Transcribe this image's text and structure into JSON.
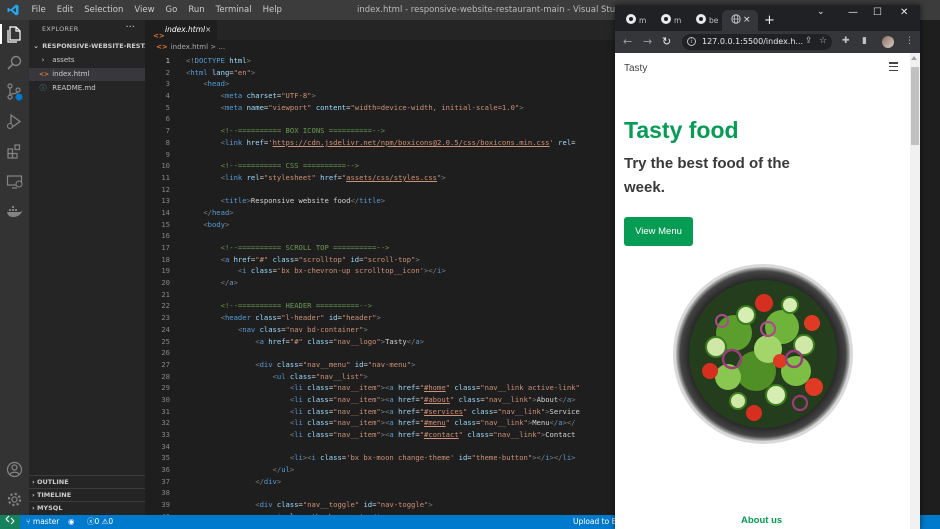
{
  "vscode": {
    "menu": [
      "File",
      "Edit",
      "Selection",
      "View",
      "Go",
      "Run",
      "Terminal",
      "Help"
    ],
    "window_title": "index.html - responsive-website-restaurant-main - Visual Studio Code",
    "explorer": {
      "header": "EXPLORER",
      "more": "···",
      "project": "RESPONSIVE-WEBSITE-RESTA...",
      "items": [
        {
          "label": "assets",
          "icon": "chevron-right-icon"
        },
        {
          "label": "index.html",
          "icon": "html-file-icon"
        },
        {
          "label": "README.md",
          "icon": "info-icon"
        }
      ],
      "sections": [
        "OUTLINE",
        "TIMELINE",
        "MYSQL"
      ]
    },
    "tab": {
      "label": "index.html",
      "close": "×",
      "icon_text": "<>"
    },
    "breadcrumb": "index.html > ...",
    "code_lines": [
      {
        "n": "1",
        "html": "<span class=\"g\">&lt;!</span><span class=\"t\">DOCTYPE</span> <span class=\"a\">html</span><span class=\"g\">&gt;</span>"
      },
      {
        "n": "2",
        "html": "<span class=\"g\">&lt;</span><span class=\"t\">html</span> <span class=\"a\">lang</span>=<span class=\"v\">\"en\"</span><span class=\"g\">&gt;</span>"
      },
      {
        "n": "3",
        "html": "    <span class=\"g\">&lt;</span><span class=\"t\">head</span><span class=\"g\">&gt;</span>"
      },
      {
        "n": "4",
        "html": "        <span class=\"g\">&lt;</span><span class=\"t\">meta</span> <span class=\"a\">charset</span>=<span class=\"v\">\"UTF-8\"</span><span class=\"g\">&gt;</span>"
      },
      {
        "n": "5",
        "html": "        <span class=\"g\">&lt;</span><span class=\"t\">meta</span> <span class=\"a\">name</span>=<span class=\"v\">\"viewport\"</span> <span class=\"a\">content</span>=<span class=\"v\">\"width=device-width, initial-scale=1.0\"</span><span class=\"g\">&gt;</span>"
      },
      {
        "n": "6",
        "html": ""
      },
      {
        "n": "7",
        "html": "        <span class=\"c\">&lt;!--========== BOX ICONS ==========--&gt;</span>"
      },
      {
        "n": "8",
        "html": "        <span class=\"g\">&lt;</span><span class=\"t\">link</span> <span class=\"a\">href</span>=<span class=\"v\">'<span class=\"u\">https://cdn.jsdelivr.net/npm/boxicons@2.0.5/css/boxicons.min.css</span>'</span> <span class=\"a\">rel</span>="
      },
      {
        "n": "9",
        "html": ""
      },
      {
        "n": "10",
        "html": "        <span class=\"c\">&lt;!--========== CSS ==========--&gt;</span>"
      },
      {
        "n": "11",
        "html": "        <span class=\"g\">&lt;</span><span class=\"t\">link</span> <span class=\"a\">rel</span>=<span class=\"v\">\"stylesheet\"</span> <span class=\"a\">href</span>=<span class=\"v\">\"<span class=\"u\">assets/css/styles.css</span>\"</span><span class=\"g\">&gt;</span>"
      },
      {
        "n": "12",
        "html": ""
      },
      {
        "n": "13",
        "html": "        <span class=\"g\">&lt;</span><span class=\"t\">title</span><span class=\"g\">&gt;</span>Responsive website food<span class=\"g\">&lt;/</span><span class=\"t\">title</span><span class=\"g\">&gt;</span>"
      },
      {
        "n": "14",
        "html": "    <span class=\"g\">&lt;/</span><span class=\"t\">head</span><span class=\"g\">&gt;</span>"
      },
      {
        "n": "15",
        "html": "    <span class=\"g\">&lt;</span><span class=\"t\">body</span><span class=\"g\">&gt;</span>"
      },
      {
        "n": "16",
        "html": ""
      },
      {
        "n": "17",
        "html": "        <span class=\"c\">&lt;!--========== SCROLL TOP ==========--&gt;</span>"
      },
      {
        "n": "18",
        "html": "        <span class=\"g\">&lt;</span><span class=\"t\">a</span> <span class=\"a\">href</span>=<span class=\"v\">\"#\"</span> <span class=\"a\">class</span>=<span class=\"v\">\"scrolltop\"</span> <span class=\"a\">id</span>=<span class=\"v\">\"scroll-top\"</span><span class=\"g\">&gt;</span>"
      },
      {
        "n": "19",
        "html": "            <span class=\"g\">&lt;</span><span class=\"t\">i</span> <span class=\"a\">class</span>=<span class=\"v\">'bx bx-chevron-up scrolltop__icon'</span><span class=\"g\">&gt;&lt;/</span><span class=\"t\">i</span><span class=\"g\">&gt;</span>"
      },
      {
        "n": "20",
        "html": "        <span class=\"g\">&lt;/</span><span class=\"t\">a</span><span class=\"g\">&gt;</span>"
      },
      {
        "n": "21",
        "html": ""
      },
      {
        "n": "22",
        "html": "        <span class=\"c\">&lt;!--========== HEADER ==========--&gt;</span>"
      },
      {
        "n": "23",
        "html": "        <span class=\"g\">&lt;</span><span class=\"t\">header</span> <span class=\"a\">class</span>=<span class=\"v\">\"l-header\"</span> <span class=\"a\">id</span>=<span class=\"v\">\"header\"</span><span class=\"g\">&gt;</span>"
      },
      {
        "n": "24",
        "html": "            <span class=\"g\">&lt;</span><span class=\"t\">nav</span> <span class=\"a\">class</span>=<span class=\"v\">\"nav bd-container\"</span><span class=\"g\">&gt;</span>"
      },
      {
        "n": "25",
        "html": "                <span class=\"g\">&lt;</span><span class=\"t\">a</span> <span class=\"a\">href</span>=<span class=\"v\">\"#\"</span> <span class=\"a\">class</span>=<span class=\"v\">\"nav__logo\"</span><span class=\"g\">&gt;</span>Tasty<span class=\"g\">&lt;/</span><span class=\"t\">a</span><span class=\"g\">&gt;</span>"
      },
      {
        "n": "26",
        "html": ""
      },
      {
        "n": "27",
        "html": "                <span class=\"g\">&lt;</span><span class=\"t\">div</span> <span class=\"a\">class</span>=<span class=\"v\">\"nav__menu\"</span> <span class=\"a\">id</span>=<span class=\"v\">\"nav-menu\"</span><span class=\"g\">&gt;</span>"
      },
      {
        "n": "28",
        "html": "                    <span class=\"g\">&lt;</span><span class=\"t\">ul</span> <span class=\"a\">class</span>=<span class=\"v\">\"nav__list\"</span><span class=\"g\">&gt;</span>"
      },
      {
        "n": "29",
        "html": "                        <span class=\"g\">&lt;</span><span class=\"t\">li</span> <span class=\"a\">class</span>=<span class=\"v\">\"nav__item\"</span><span class=\"g\">&gt;&lt;</span><span class=\"t\">a</span> <span class=\"a\">href</span>=<span class=\"v\">\"<span class=\"u\">#home</span>\"</span> <span class=\"a\">class</span>=<span class=\"v\">\"nav__link active-link\"</span>"
      },
      {
        "n": "30",
        "html": "                        <span class=\"g\">&lt;</span><span class=\"t\">li</span> <span class=\"a\">class</span>=<span class=\"v\">\"nav__item\"</span><span class=\"g\">&gt;&lt;</span><span class=\"t\">a</span> <span class=\"a\">href</span>=<span class=\"v\">\"<span class=\"u\">#about</span>\"</span> <span class=\"a\">class</span>=<span class=\"v\">\"nav__link\"</span><span class=\"g\">&gt;</span>About<span class=\"g\">&lt;/</span><span class=\"t\">a</span><span class=\"g\">&gt;</span>"
      },
      {
        "n": "31",
        "html": "                        <span class=\"g\">&lt;</span><span class=\"t\">li</span> <span class=\"a\">class</span>=<span class=\"v\">\"nav__item\"</span><span class=\"g\">&gt;&lt;</span><span class=\"t\">a</span> <span class=\"a\">href</span>=<span class=\"v\">\"<span class=\"u\">#services</span>\"</span> <span class=\"a\">class</span>=<span class=\"v\">\"nav__link\"</span><span class=\"g\">&gt;</span>Service"
      },
      {
        "n": "32",
        "html": "                        <span class=\"g\">&lt;</span><span class=\"t\">li</span> <span class=\"a\">class</span>=<span class=\"v\">\"nav__item\"</span><span class=\"g\">&gt;&lt;</span><span class=\"t\">a</span> <span class=\"a\">href</span>=<span class=\"v\">\"<span class=\"u\">#menu</span>\"</span> <span class=\"a\">class</span>=<span class=\"v\">\"nav__link\"</span><span class=\"g\">&gt;</span>Menu<span class=\"g\">&lt;/</span><span class=\"t\">a</span><span class=\"g\">&gt;&lt;/</span>"
      },
      {
        "n": "33",
        "html": "                        <span class=\"g\">&lt;</span><span class=\"t\">li</span> <span class=\"a\">class</span>=<span class=\"v\">\"nav__item\"</span><span class=\"g\">&gt;&lt;</span><span class=\"t\">a</span> <span class=\"a\">href</span>=<span class=\"v\">\"<span class=\"u\">#contact</span>\"</span> <span class=\"a\">class</span>=<span class=\"v\">\"nav__link\"</span><span class=\"g\">&gt;</span>Contact"
      },
      {
        "n": "34",
        "html": ""
      },
      {
        "n": "35",
        "html": "                        <span class=\"g\">&lt;</span><span class=\"t\">li</span><span class=\"g\">&gt;&lt;</span><span class=\"t\">i</span> <span class=\"a\">class</span>=<span class=\"v\">'bx bx-moon change-theme'</span> <span class=\"a\">id</span>=<span class=\"v\">\"theme-button\"</span><span class=\"g\">&gt;&lt;/</span><span class=\"t\">i</span><span class=\"g\">&gt;&lt;/</span><span class=\"t\">li</span><span class=\"g\">&gt;</span>"
      },
      {
        "n": "36",
        "html": "                    <span class=\"g\">&lt;/</span><span class=\"t\">ul</span><span class=\"g\">&gt;</span>"
      },
      {
        "n": "37",
        "html": "                <span class=\"g\">&lt;/</span><span class=\"t\">div</span><span class=\"g\">&gt;</span>"
      },
      {
        "n": "38",
        "html": ""
      },
      {
        "n": "39",
        "html": "                <span class=\"g\">&lt;</span><span class=\"t\">div</span> <span class=\"a\">class</span>=<span class=\"v\">\"nav__toggle\"</span> <span class=\"a\">id</span>=<span class=\"v\">\"nav-toggle\"</span><span class=\"g\">&gt;</span>"
      },
      {
        "n": "40",
        "html": "                    <span class=\"g\">&lt;</span><span class=\"t\">i</span> <span class=\"a\">class</span>=<span class=\"v\">'bx bx-menu'</span><span class=\"g\">&gt;&lt;/</span><span class=\"t\">i</span><span class=\"g\">&gt;</span>"
      }
    ],
    "status": {
      "branch": "master",
      "errors": "0",
      "warnings": "0",
      "right_text": "Upload to Bl"
    }
  },
  "browser": {
    "tabs": [
      {
        "label": "m",
        "icon": "github-icon"
      },
      {
        "label": "m",
        "icon": "github-icon"
      },
      {
        "label": "be",
        "icon": "github-icon"
      },
      {
        "label": "",
        "icon": "globe-icon",
        "active": true
      }
    ],
    "close_tab": "×",
    "new_tab": "+",
    "url": "127.0.0.1:5500/index.h...",
    "page": {
      "brand": "Tasty",
      "title": "Tasty food",
      "subtitle": "Try the best food of the week.",
      "button": "View Menu",
      "section_heading": "About us"
    }
  },
  "colors": {
    "accent": "#069c54",
    "vscode_blue": "#007acc"
  }
}
